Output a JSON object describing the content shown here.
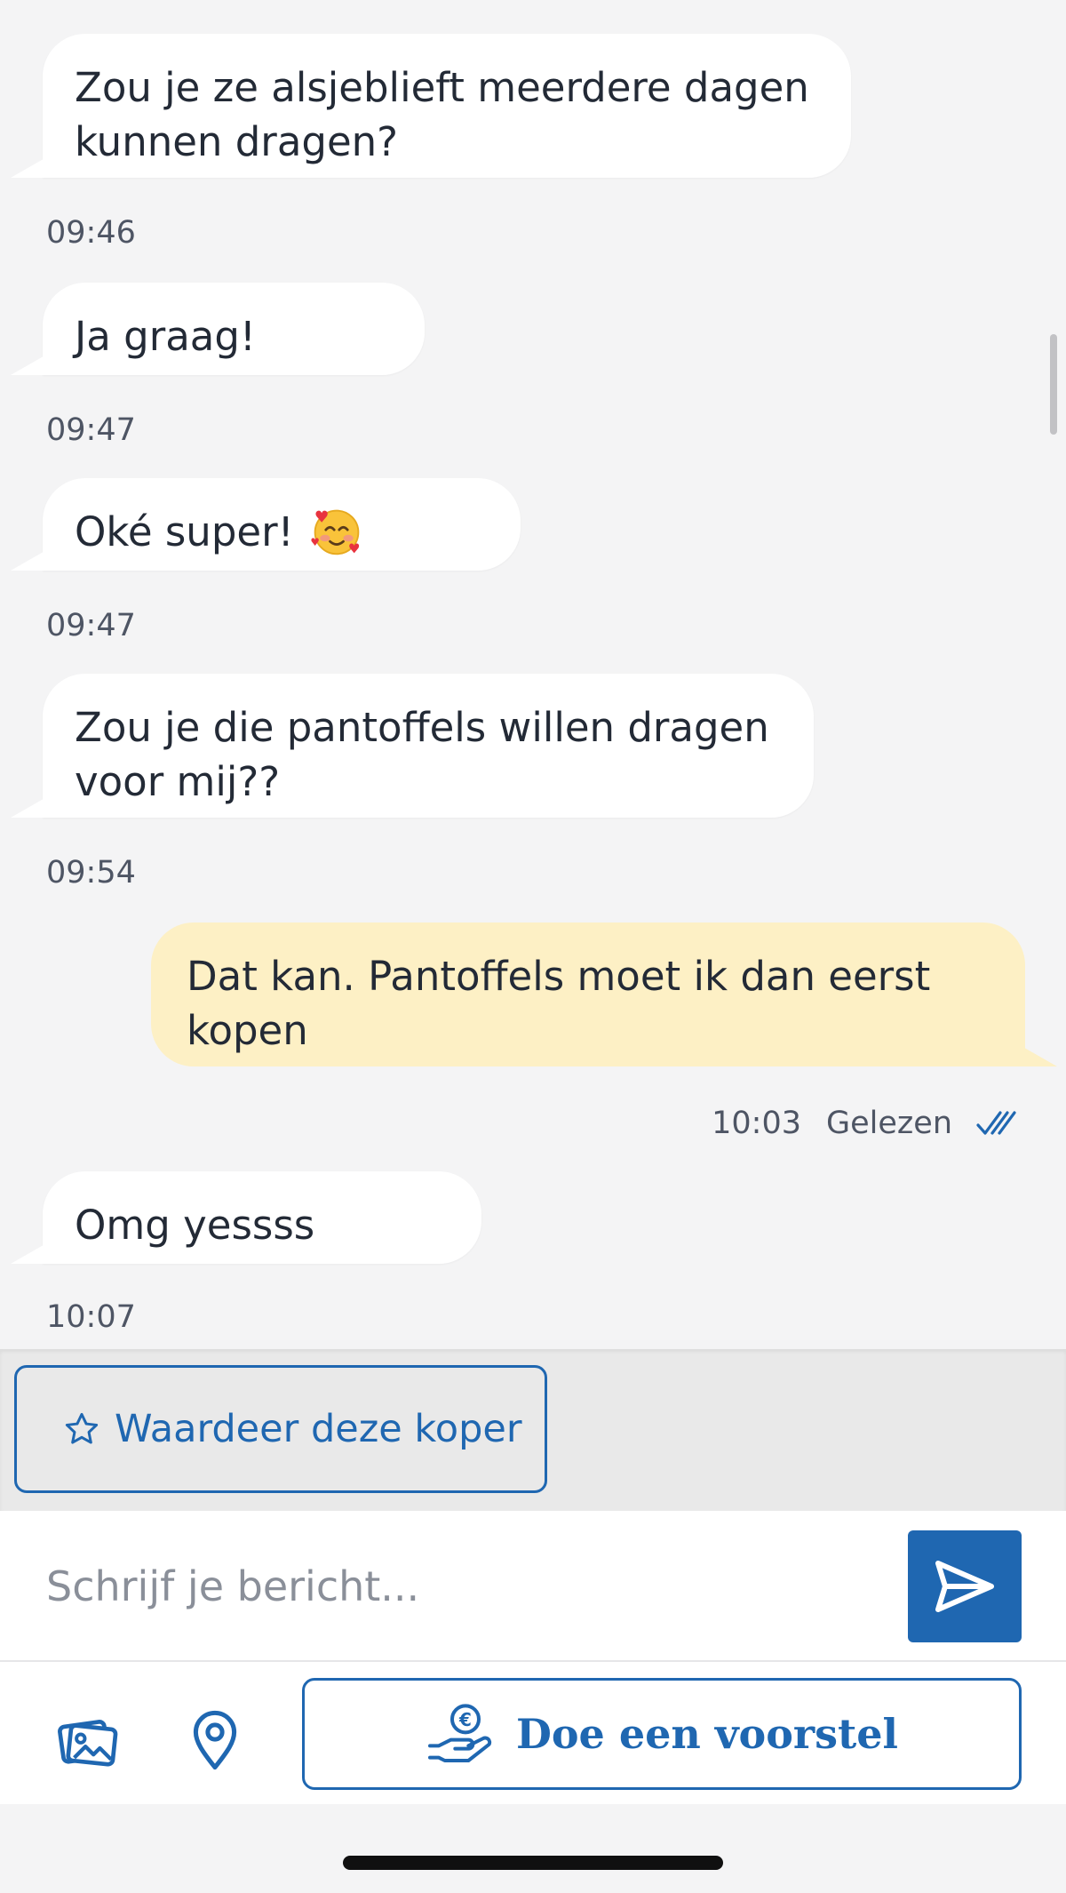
{
  "messages": [
    {
      "direction": "in",
      "text": "Zou je ze alsjeblieft meerdere dagen\nkunnen dragen?",
      "time": "09:46"
    },
    {
      "direction": "in",
      "text": "Ja graag!",
      "time": "09:47"
    },
    {
      "direction": "in",
      "text": "Oké super!",
      "emoji": "smiling-face-with-hearts",
      "time": "09:47"
    },
    {
      "direction": "in",
      "text": "Zou je die pantoffels willen dragen\nvoor mij??",
      "time": "09:54"
    },
    {
      "direction": "out",
      "text": "Dat kan. Pantoffels moet ik dan eerst\nkopen",
      "time": "10:03",
      "status": "Gelezen"
    },
    {
      "direction": "in",
      "text": "Omg yessss",
      "time": "10:07"
    }
  ],
  "rate_button": {
    "label": "Waardeer deze koper",
    "icon": "star-outline-icon"
  },
  "compose": {
    "placeholder": "Schrijf je bericht...",
    "send_icon": "send-icon"
  },
  "actions": {
    "photo_icon": "photos-icon",
    "location_icon": "location-pin-icon",
    "offer_label": "Doe een voorstel",
    "offer_icon": "hand-euro-coin-icon"
  },
  "colors": {
    "accent": "#1f67b1",
    "incoming_bubble": "#ffffff",
    "outgoing_bubble": "#fdf0c5",
    "background": "#f4f4f5",
    "text": "#232a36",
    "meta_text": "#4e5564"
  }
}
